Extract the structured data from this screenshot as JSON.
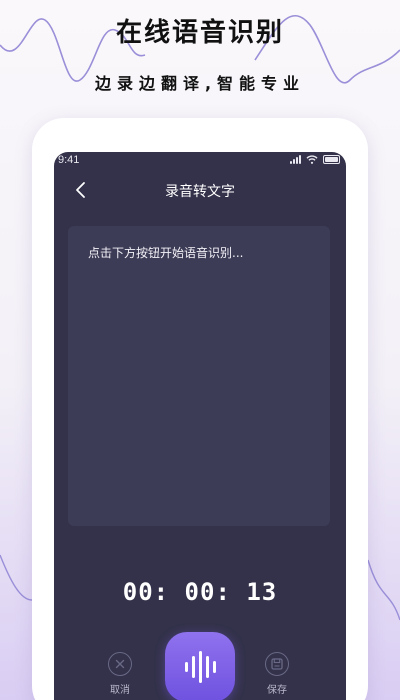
{
  "promo": {
    "headline": "在线语音识别",
    "subline": "边录边翻译,智能专业"
  },
  "colors": {
    "accent": "#7a5ce6",
    "screen_bg": "#33324a",
    "card_bg": "#3d3c56"
  },
  "status_bar": {
    "time": "9:41",
    "icons": [
      "signal-icon",
      "wifi-icon",
      "battery-icon"
    ]
  },
  "nav": {
    "back_icon": "chevron-left-icon",
    "title": "录音转文字"
  },
  "transcript": {
    "placeholder": "点击下方按钮开始语音识别..."
  },
  "timer": {
    "display": "00: 00: 13"
  },
  "controls": {
    "cancel_label": "取消",
    "cancel_icon": "close-icon",
    "record_icon": "sound-wave-icon",
    "save_label": "保存",
    "save_icon": "save-icon"
  }
}
